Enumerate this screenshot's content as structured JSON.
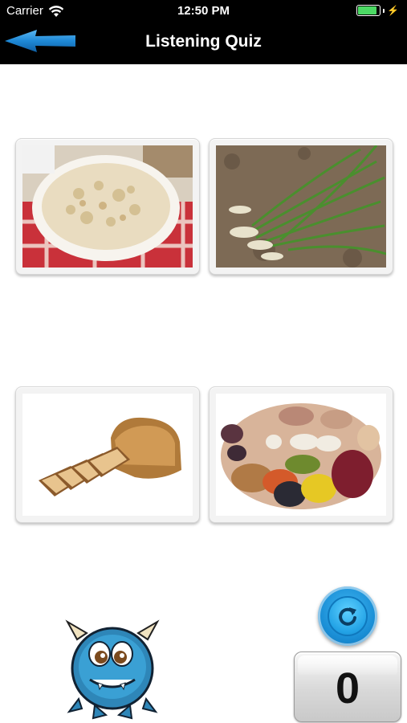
{
  "status_bar": {
    "carrier": "Carrier",
    "time": "12:50 PM",
    "battery_level": 0.9,
    "charging": true
  },
  "nav": {
    "title": "Listening Quiz",
    "back_icon": "back-arrow-icon"
  },
  "answer_choices": [
    {
      "image": "oatmeal-bowl"
    },
    {
      "image": "green-onions-in-soil"
    },
    {
      "image": "sliced-bread-loaf"
    },
    {
      "image": "mixed-beans-legumes"
    }
  ],
  "controls": {
    "replay_icon": "replay-icon",
    "score": "0"
  },
  "mascot": "blue-monster-mascot",
  "colors": {
    "nav_background": "#000000",
    "back_arrow": "#1e88d6",
    "replay_button": "#1b8fd6",
    "battery": "#4cd964"
  }
}
